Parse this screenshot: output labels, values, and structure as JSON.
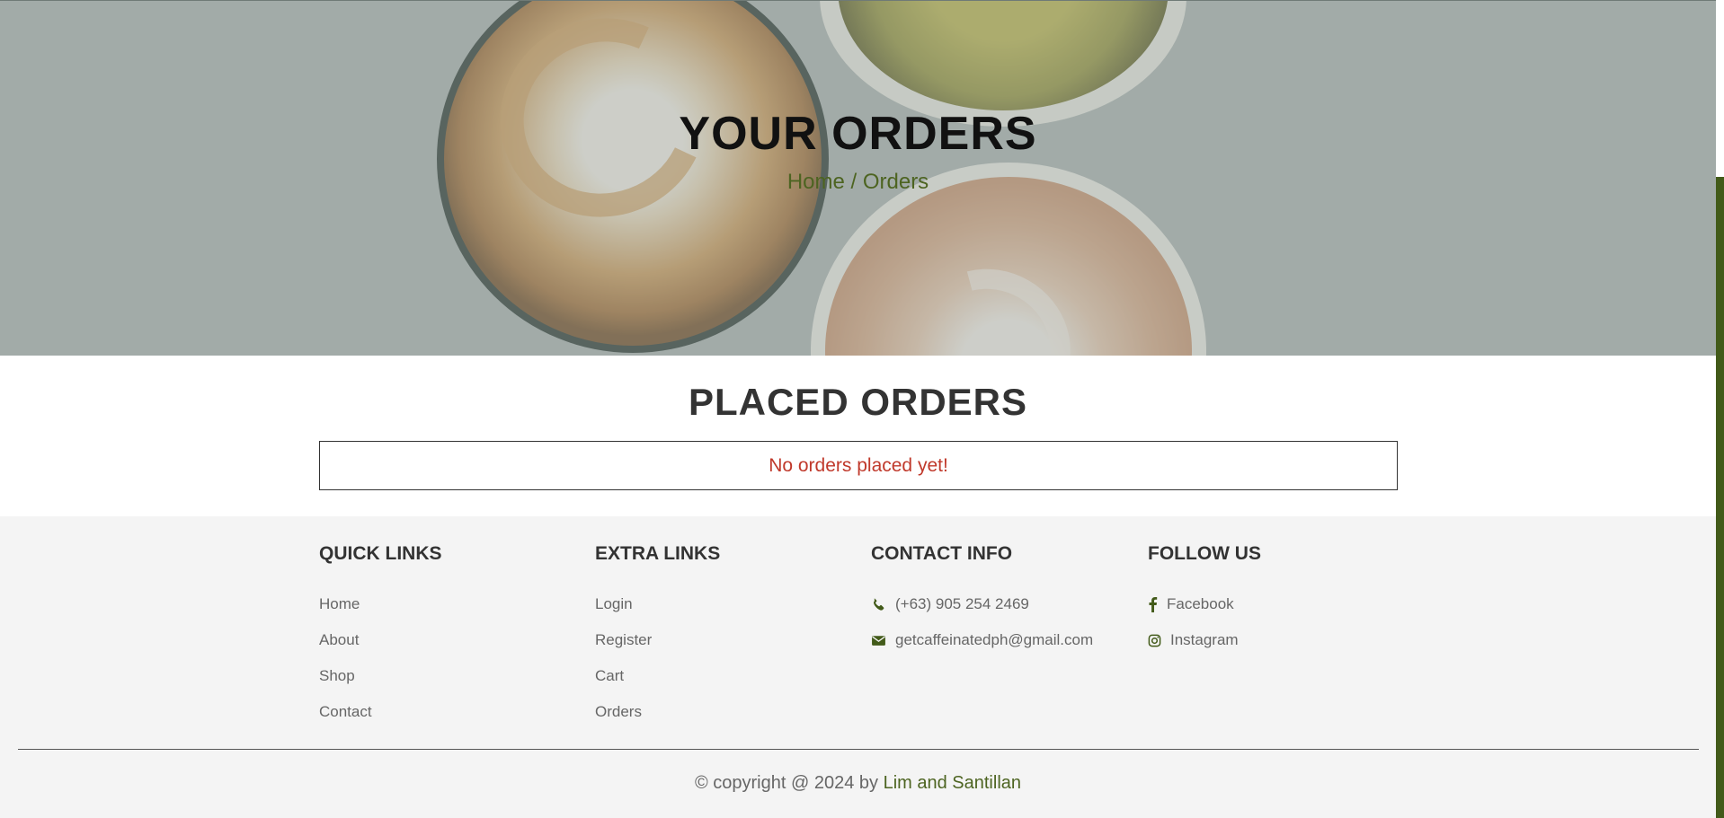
{
  "hero": {
    "title": "YOUR ORDERS",
    "breadcrumb": "Home / Orders"
  },
  "orders": {
    "title": "PLACED ORDERS",
    "empty_message": "No orders placed yet!"
  },
  "footer": {
    "quick_links": {
      "title": "QUICK LINKS",
      "items": [
        "Home",
        "About",
        "Shop",
        "Contact"
      ]
    },
    "extra_links": {
      "title": "EXTRA LINKS",
      "items": [
        "Login",
        "Register",
        "Cart",
        "Orders"
      ]
    },
    "contact_info": {
      "title": "CONTACT INFO",
      "phone": "(+63) 905 254 2469",
      "email": "getcaffeinatedph@gmail.com",
      "phone_icon": "phone-icon",
      "email_icon": "envelope-icon"
    },
    "follow_us": {
      "title": "FOLLOW US",
      "facebook": "Facebook",
      "instagram": "Instagram",
      "facebook_icon": "facebook-icon",
      "instagram_icon": "instagram-icon"
    },
    "copyright_prefix": "© copyright @ 2024 by",
    "copyright_authors": "Lim and Santillan"
  },
  "colors": {
    "accent": "#425a19",
    "empty_message": "#c0392b"
  }
}
